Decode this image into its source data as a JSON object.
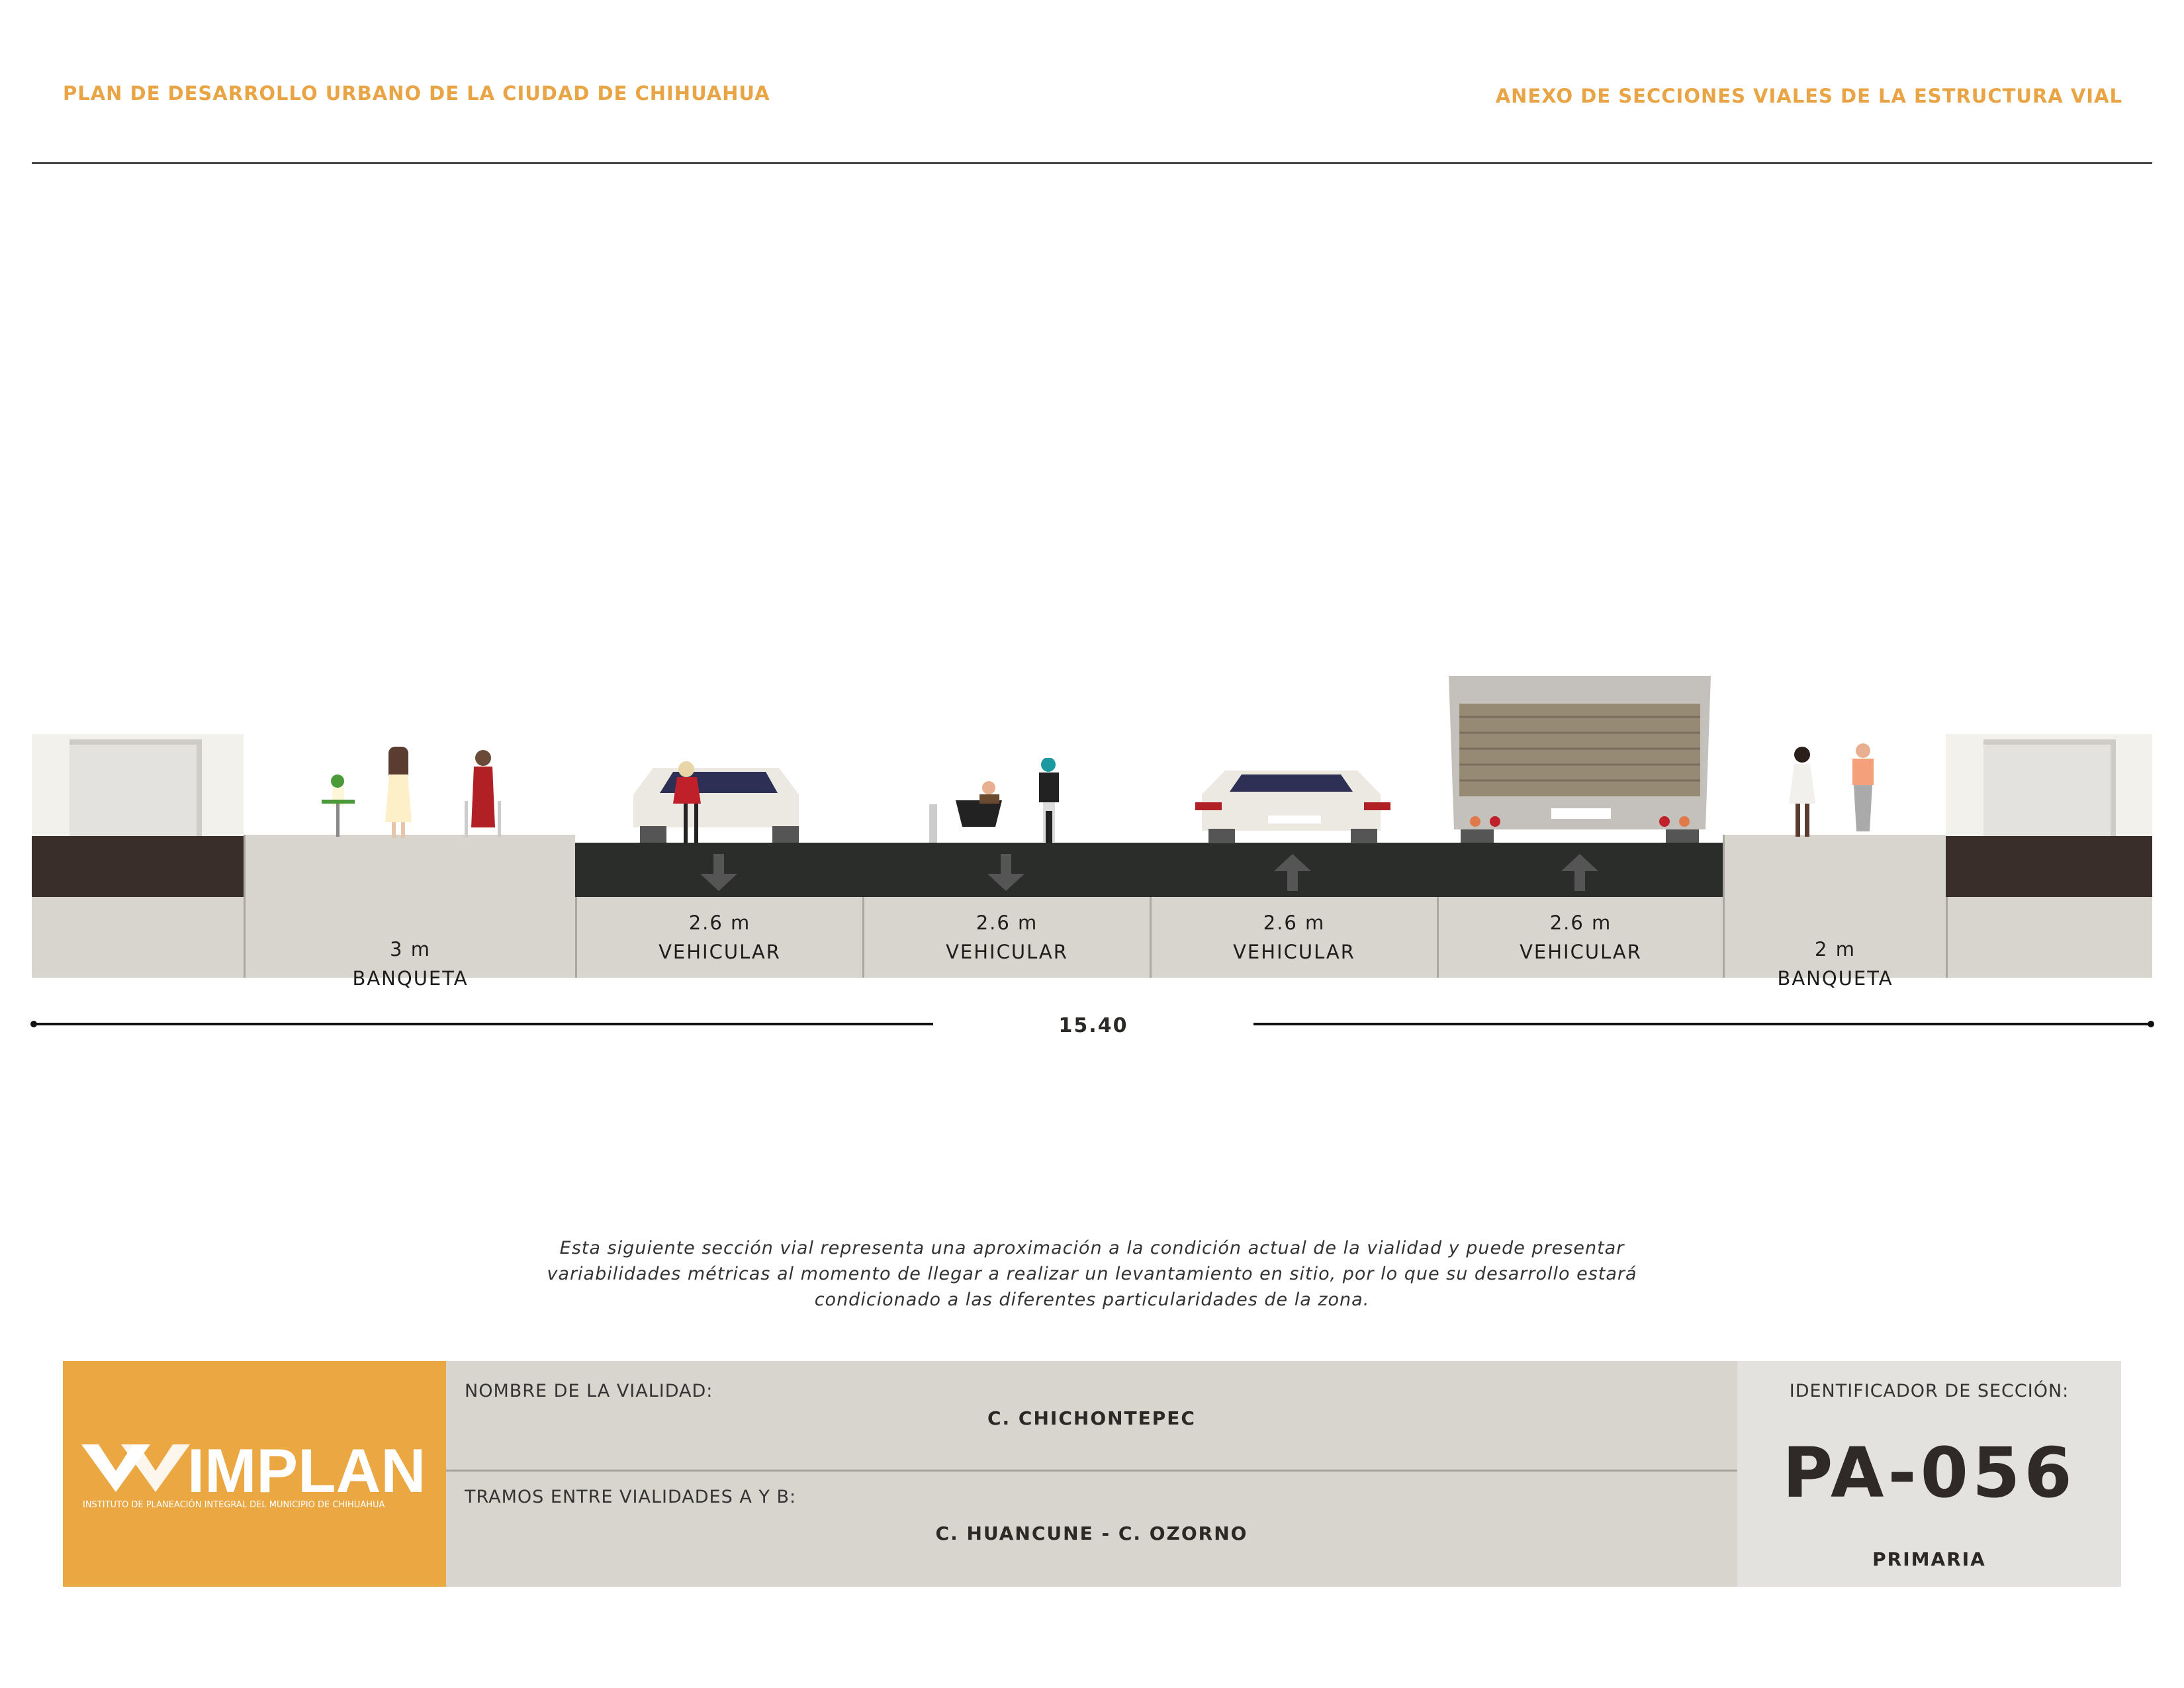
{
  "header": {
    "left_title": "PLAN DE DESARROLLO URBANO DE LA CIUDAD DE CHIHUAHUA",
    "right_title": "ANEXO DE SECCIONES VIALES DE LA ESTRUCTURA VIAL"
  },
  "section": {
    "segments": [
      {
        "width": "3 m",
        "type": "BANQUETA"
      },
      {
        "width": "2.6 m",
        "type": "VEHICULAR",
        "direction": "down"
      },
      {
        "width": "2.6 m",
        "type": "VEHICULAR",
        "direction": "down"
      },
      {
        "width": "2.6 m",
        "type": "VEHICULAR",
        "direction": "up"
      },
      {
        "width": "2.6 m",
        "type": "VEHICULAR",
        "direction": "up"
      },
      {
        "width": "2 m",
        "type": "BANQUETA"
      }
    ],
    "total_width": "15.40",
    "colors": {
      "road": "#2b2d2b",
      "sidewalk": "#d8d4ce",
      "accent": "#e9a545"
    }
  },
  "note": {
    "lines": [
      "Esta siguiente sección vial representa una aproximación a la condición actual de la vialidad y puede presentar",
      "variabilidades métricas al momento de llegar a realizar un levantamiento en sitio, por lo que su desarrollo estará",
      "condicionado a las diferentes particularidades de la zona."
    ]
  },
  "info": {
    "logo": {
      "name": "IMPLAN",
      "subtitle": "INSTITUTO DE PLANEACIÓN INTEGRAL DEL MUNICIPIO DE CHIHUAHUA"
    },
    "road_name_label": "NOMBRE DE LA VIALIDAD:",
    "road_name": "C. CHICHONTEPEC",
    "segment_label": "TRAMOS ENTRE VIALIDADES A Y B:",
    "segment": "C. HUANCUNE - C. OZORNO",
    "id_label": "IDENTIFICADOR DE SECCIÓN:",
    "id": "PA-056",
    "classification": "PRIMARIA"
  }
}
